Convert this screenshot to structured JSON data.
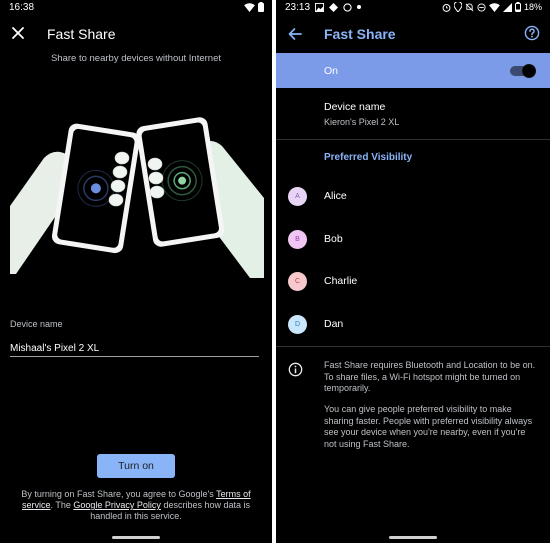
{
  "left": {
    "status": {
      "time": "16:38"
    },
    "title": "Fast Share",
    "subtitle": "Share to nearby devices without Internet",
    "device_name_label": "Device name",
    "device_name_value": "Mishaal's Pixel 2 XL",
    "turn_on_label": "Turn on",
    "legal": {
      "part1": "By turning on Fast Share, you agree to Google's ",
      "terms_link": "Terms of service",
      "part2": ". The ",
      "privacy_link": "Google Privacy Policy",
      "part3": " describes how data is handled in this service."
    },
    "icons": {
      "close": "close-icon",
      "wifi": "wifi-icon",
      "battery": "battery-icon"
    }
  },
  "right": {
    "status": {
      "time": "23:13",
      "battery": "18%"
    },
    "title": "Fast Share",
    "on_label": "On",
    "toggle_on": true,
    "device_name_label": "Device name",
    "device_name_value": "Kieron's Pixel 2 XL",
    "preferred_heading": "Preferred Visibility",
    "people": [
      {
        "initial": "A",
        "name": "Alice",
        "bg": "#e8d5f5",
        "fg": "#8a5cb8"
      },
      {
        "initial": "B",
        "name": "Bob",
        "bg": "#f0c6f2",
        "fg": "#a03cae"
      },
      {
        "initial": "C",
        "name": "Charlie",
        "bg": "#f6c9cc",
        "fg": "#c0464e"
      },
      {
        "initial": "D",
        "name": "Dan",
        "bg": "#c9e6fb",
        "fg": "#2f7ec0"
      }
    ],
    "info_text_1": "Fast Share requires Bluetooth and Location to be on. To share files, a Wi-Fi hotspot might be turned on temporarily.",
    "info_text_2": "You can give people preferred visibility to make sharing faster. People with preferred visibility always see your device when you're nearby, even if you're not using Fast Share.",
    "icons": {
      "back": "back-arrow-icon",
      "help": "help-icon",
      "info": "info-icon"
    }
  },
  "colors": {
    "accent": "#8ab4f8",
    "on_bar": "#7b9be8",
    "background": "#000000"
  }
}
